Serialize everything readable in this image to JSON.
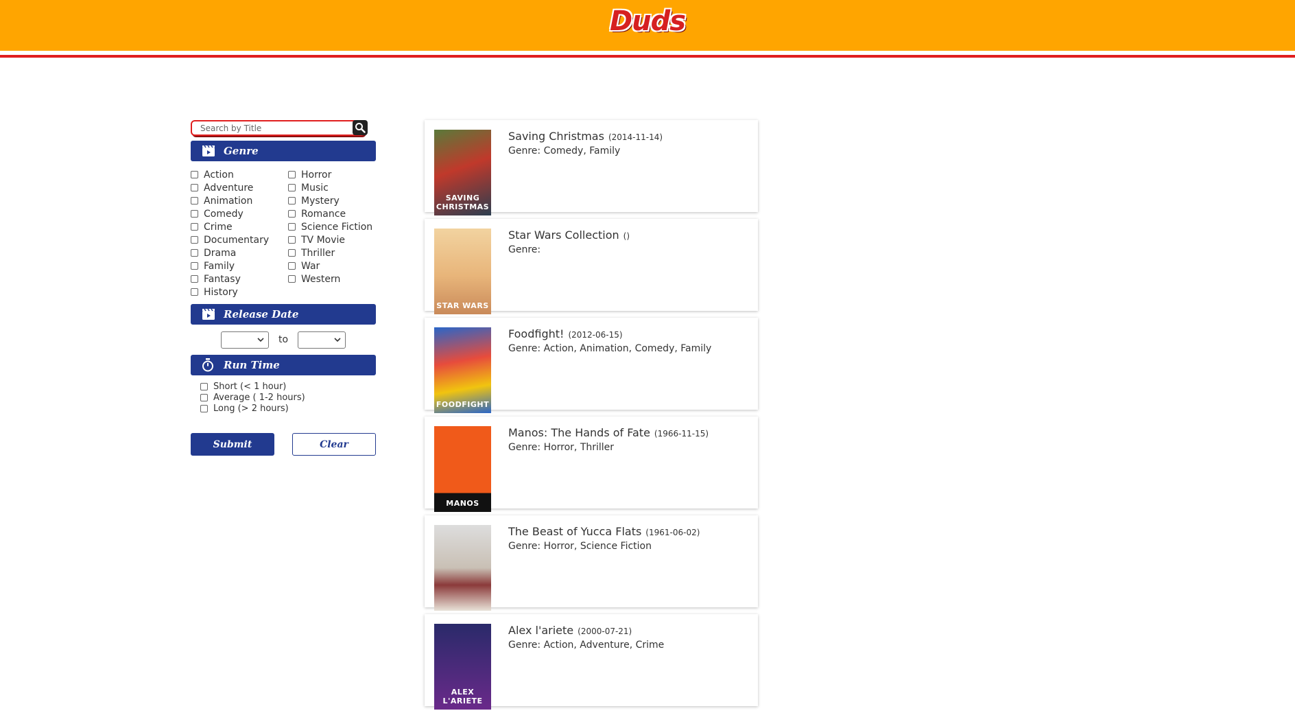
{
  "header": {
    "logo_text": "Duds"
  },
  "search": {
    "placeholder": "Search by Title",
    "icon": "search-icon"
  },
  "genre_section": {
    "title": "Genre",
    "col1": [
      "Action",
      "Adventure",
      "Animation",
      "Comedy",
      "Crime",
      "Documentary",
      "Drama",
      "Family",
      "Fantasy",
      "History"
    ],
    "col2": [
      "Horror",
      "Music",
      "Mystery",
      "Romance",
      "Science Fiction",
      "TV Movie",
      "Thriller",
      "War",
      "Western"
    ]
  },
  "release_section": {
    "title": "Release Date",
    "to_label": "to",
    "from_value": "",
    "to_value": ""
  },
  "runtime_section": {
    "title": "Run Time",
    "options": [
      "Short (< 1 hour)",
      "Average ( 1-2 hours)",
      "Long (> 2 hours)"
    ]
  },
  "buttons": {
    "submit": "Submit",
    "clear": "Clear"
  },
  "movies": [
    {
      "title": "Saving Christmas",
      "date": "(2014-11-14)",
      "genre": "Genre: Comedy, Family",
      "poster_text": "SAVING CHRISTMAS"
    },
    {
      "title": "Star Wars Collection",
      "date": "()",
      "genre": "Genre:",
      "poster_text": "STAR WARS"
    },
    {
      "title": "Foodfight!",
      "date": "(2012-06-15)",
      "genre": "Genre: Action, Animation, Comedy, Family",
      "poster_text": "FOODFIGHT"
    },
    {
      "title": "Manos: The Hands of Fate",
      "date": "(1966-11-15)",
      "genre": "Genre: Horror, Thriller",
      "poster_text": "MANOS"
    },
    {
      "title": "The Beast of Yucca Flats",
      "date": "(1961-06-02)",
      "genre": "Genre: Horror, Science Fiction",
      "poster_text": ""
    },
    {
      "title": "Alex l'ariete",
      "date": "(2000-07-21)",
      "genre": "Genre: Action, Adventure, Crime",
      "poster_text": "ALEX L'ARIETE"
    }
  ],
  "colors": {
    "header_bg": "#ffa500",
    "header_line": "#e01e1e",
    "section_bar": "#223a8f"
  }
}
